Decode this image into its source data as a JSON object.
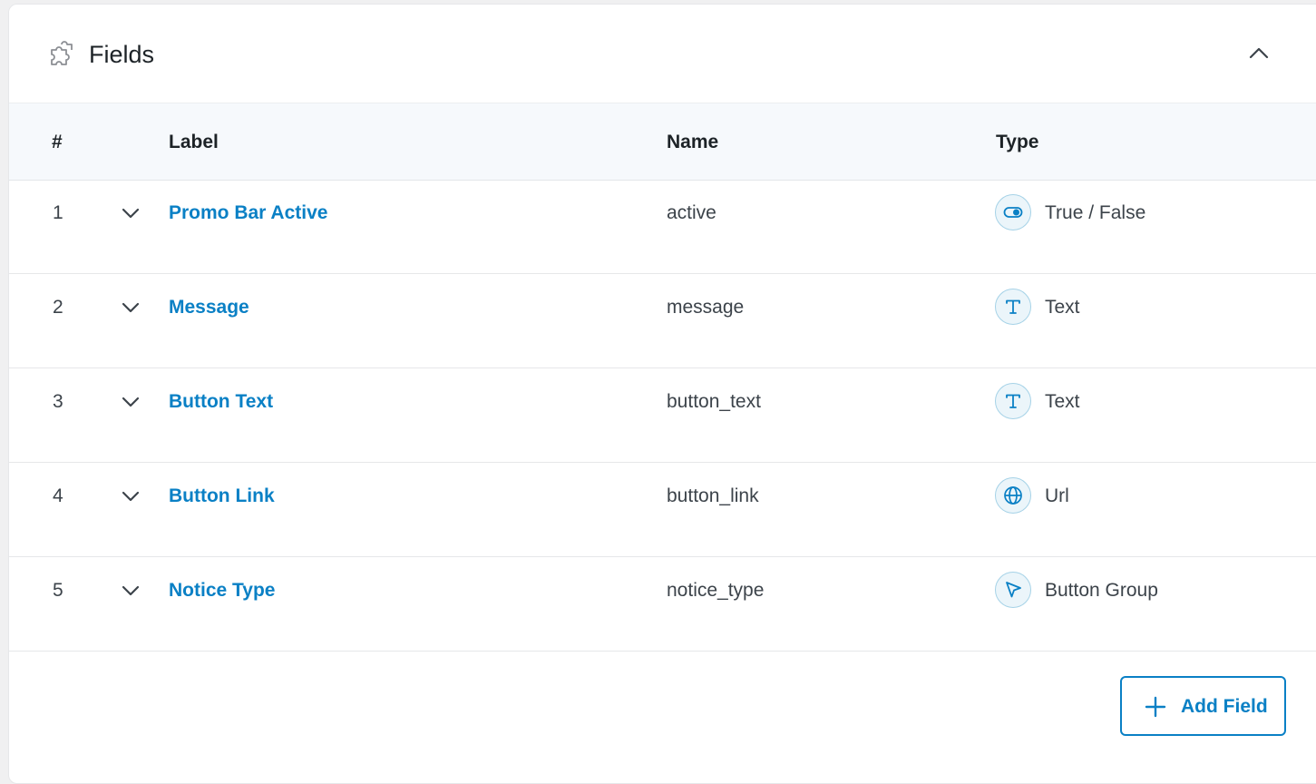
{
  "header": {
    "title": "Fields",
    "icon": "puzzle-icon",
    "collapse_icon": "chevron-up-icon"
  },
  "columns": {
    "num": "#",
    "label": "Label",
    "name": "Name",
    "type": "Type"
  },
  "fields": [
    {
      "num": "1",
      "label": "Promo Bar Active",
      "name": "active",
      "type": "True / False",
      "type_icon": "toggle-icon"
    },
    {
      "num": "2",
      "label": "Message",
      "name": "message",
      "type": "Text",
      "type_icon": "text-icon"
    },
    {
      "num": "3",
      "label": "Button Text",
      "name": "button_text",
      "type": "Text",
      "type_icon": "text-icon"
    },
    {
      "num": "4",
      "label": "Button Link",
      "name": "button_link",
      "type": "Url",
      "type_icon": "globe-icon"
    },
    {
      "num": "5",
      "label": "Notice Type",
      "name": "notice_type",
      "type": "Button Group",
      "type_icon": "cursor-icon"
    }
  ],
  "add_button": {
    "label": "Add Field",
    "icon": "plus-icon"
  },
  "colors": {
    "accent": "#0a80c5",
    "icon_bg": "#ebf5fa",
    "header_bg": "#f6f9fc"
  }
}
